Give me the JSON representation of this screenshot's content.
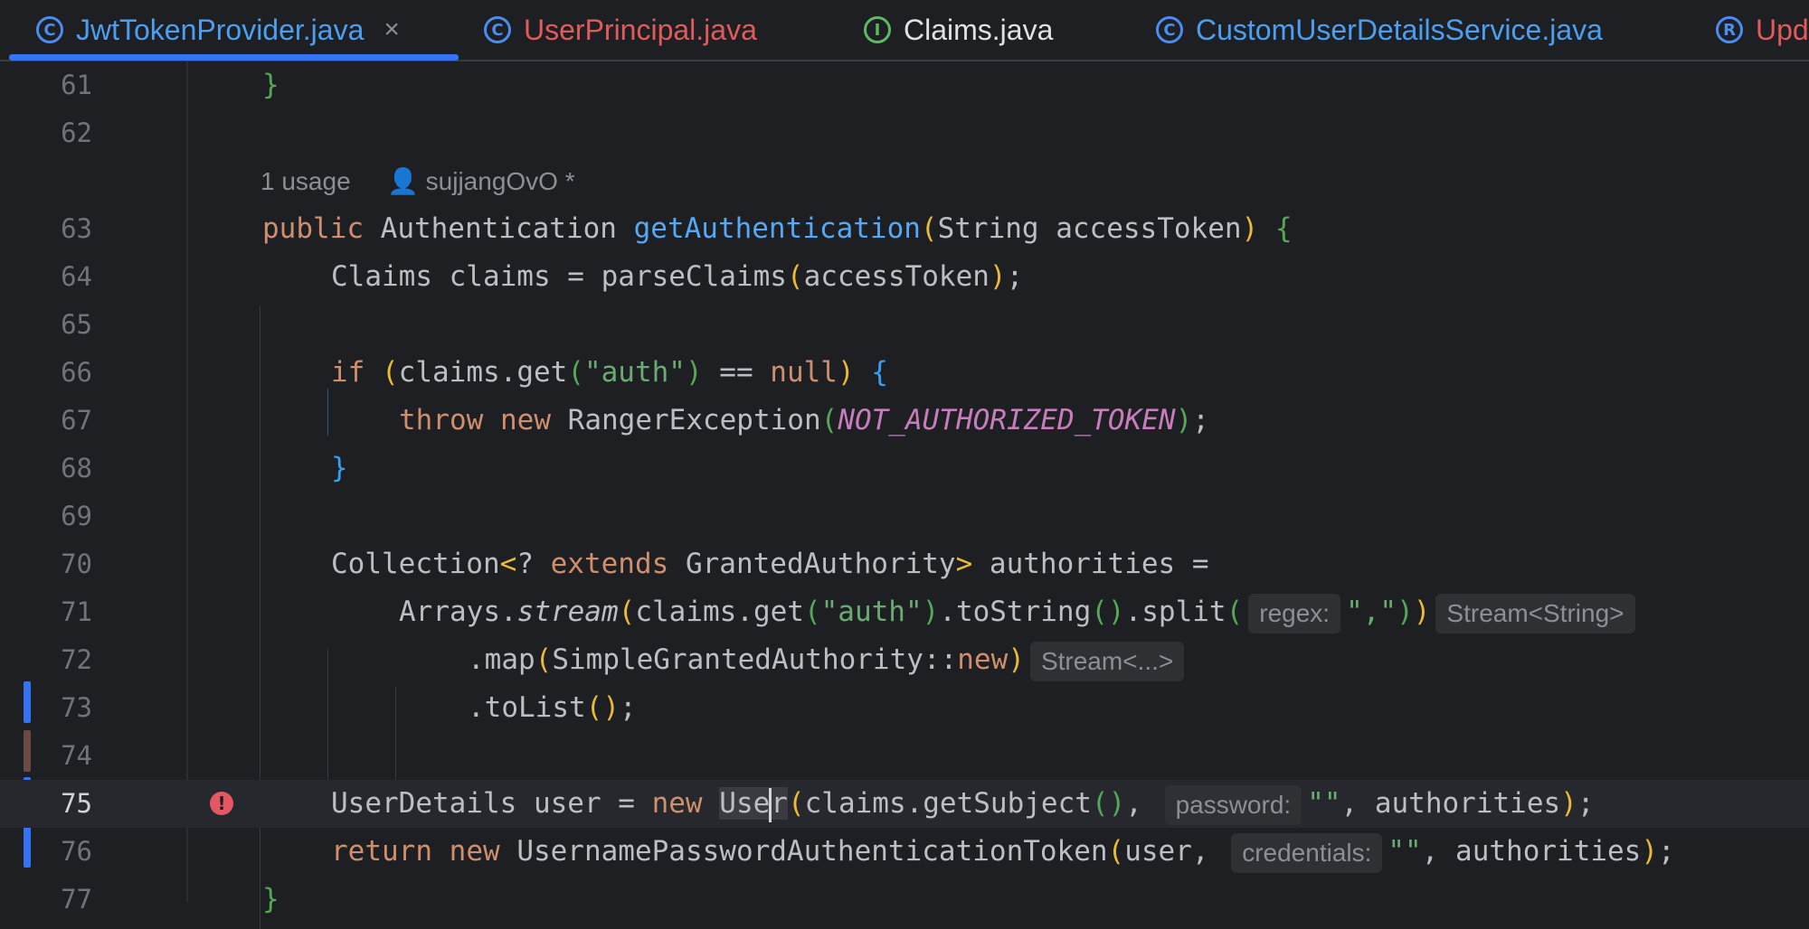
{
  "tabs": [
    {
      "label": "JwtTokenProvider.java",
      "icon_letter": "C",
      "color": "#4a9ff0",
      "active": true
    },
    {
      "label": "UserPrincipal.java",
      "icon_letter": "C",
      "color": "#e05b5b",
      "active": false
    },
    {
      "label": "Claims.java",
      "icon_letter": "I",
      "color": "#dfe1e5",
      "active": false
    },
    {
      "label": "CustomUserDetailsService.java",
      "icon_letter": "C",
      "color": "#4a9ff0",
      "active": false
    },
    {
      "label": "Upd",
      "icon_letter": "R",
      "color": "#e05b5b",
      "active": false
    }
  ],
  "close_glyph": "×",
  "inlay": {
    "usages": "1 usage",
    "author": "sujjangOvO *",
    "regex": "regex:",
    "stream_string": "Stream<String>",
    "stream_any": "Stream<...>",
    "password": "password:",
    "credentials": "credentials:"
  },
  "line_numbers": [
    "61",
    "62",
    "63",
    "64",
    "65",
    "66",
    "67",
    "68",
    "69",
    "70",
    "71",
    "72",
    "73",
    "74",
    "75",
    "76",
    "77"
  ],
  "colors": {
    "keyword": "#cf8e6d",
    "function": "#56a8f5",
    "string": "#6aab73",
    "constant": "#c77dbb",
    "error": "#e55765",
    "accent": "#3574f0"
  },
  "code": {
    "l61": "}",
    "l63_kw": "public",
    "l63_type": "Authentication",
    "l63_fn": "getAuthentication",
    "l63_params": "String accessToken",
    "l64": "Claims claims = parseClaims",
    "l64_arg": "accessToken",
    "l66_kw": "if",
    "l66_a": "claims.get",
    "l66_str": "\"auth\"",
    "l66_op": " == ",
    "l66_null": "null",
    "l67_throw": "throw",
    "l67_new": "new",
    "l67_cls": "RangerException",
    "l67_const": "NOT_AUTHORIZED_TOKEN",
    "l70_a": "Collection",
    "l70_b": "? ",
    "l70_ext": "extends",
    "l70_c": " GrantedAuthority",
    "l70_d": " authorities =",
    "l71_a": "Arrays.",
    "l71_stream": "stream",
    "l71_b": "claims.get",
    "l71_str": "\"auth\"",
    "l71_c": ".toString",
    "l71_d": ".split",
    "l71_split": "\",\"",
    "l72_a": ".map",
    "l72_b": "SimpleGrantedAuthority::",
    "l72_new": "new",
    "l73": ".toList",
    "l75_a": "UserDetails user = ",
    "l75_new": "new",
    "l75_cls_a": "Use",
    "l75_cls_b": "r",
    "l75_b": "claims.getSubject",
    "l75_str": "\"\"",
    "l75_c": ", authorities",
    "l76_ret": "return",
    "l76_new": "new",
    "l76_a": " UsernamePasswordAuthenticationToken",
    "l76_b": "user, ",
    "l76_str": "\"\"",
    "l76_c": ", authorities",
    "l77": "}"
  }
}
